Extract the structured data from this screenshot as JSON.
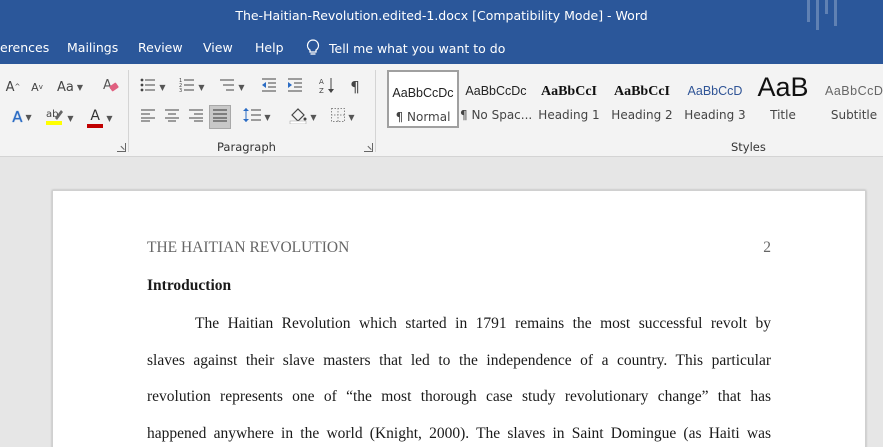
{
  "titlebar": {
    "title": "The-Haitian-Revolution.edited-1.docx [Compatibility Mode]  -  Word",
    "bg_color": "#2b579a"
  },
  "menubar": {
    "items": [
      "erences",
      "Mailings",
      "Review",
      "View",
      "Help"
    ],
    "tell_me": "Tell me what you want to do",
    "tell_me_icon": "lightbulb-icon"
  },
  "ribbon": {
    "font_group": {
      "grow_font": "A",
      "shrink_font": "A",
      "change_case": "Aa",
      "clear_formatting_icon": "eraser-icon",
      "text_effects": "A",
      "highlight_icon": "highlighter-icon",
      "font_color": "A",
      "highlight_color": "#ffff00",
      "font_color_value": "#c00000"
    },
    "paragraph_group": {
      "label": "Paragraph",
      "active_alignment": "justify"
    },
    "styles_group": {
      "label": "Styles",
      "tiles": [
        {
          "sample": "AaBbCcDc",
          "name": "¶ Normal",
          "selected": true
        },
        {
          "sample": "AaBbCcDc",
          "name": "¶ No Spac...",
          "selected": false
        },
        {
          "sample": "AaBbCcI",
          "name": "Heading 1",
          "selected": false
        },
        {
          "sample": "AaBbCcI",
          "name": "Heading 2",
          "selected": false
        },
        {
          "sample": "AaBbCcD",
          "name": "Heading 3",
          "selected": false
        },
        {
          "sample": "AaB",
          "name": "Title",
          "selected": false
        },
        {
          "sample": "AaBbCcD",
          "name": "Subtitle",
          "selected": false
        }
      ]
    }
  },
  "document": {
    "header_left": "THE HAITIAN REVOLUTION",
    "header_right": "2",
    "heading": "Introduction",
    "lines": [
      "The Haitian Revolution which started in 1791 remains the most successful revolt by",
      "slaves against their slave masters that led to the independence of a country. This particular",
      "revolution represents one of “the most thorough case study revolutionary change” that has",
      "happened anywhere in the world (Knight, 2000).  The slaves in Saint Domingue (as Haiti was"
    ]
  }
}
